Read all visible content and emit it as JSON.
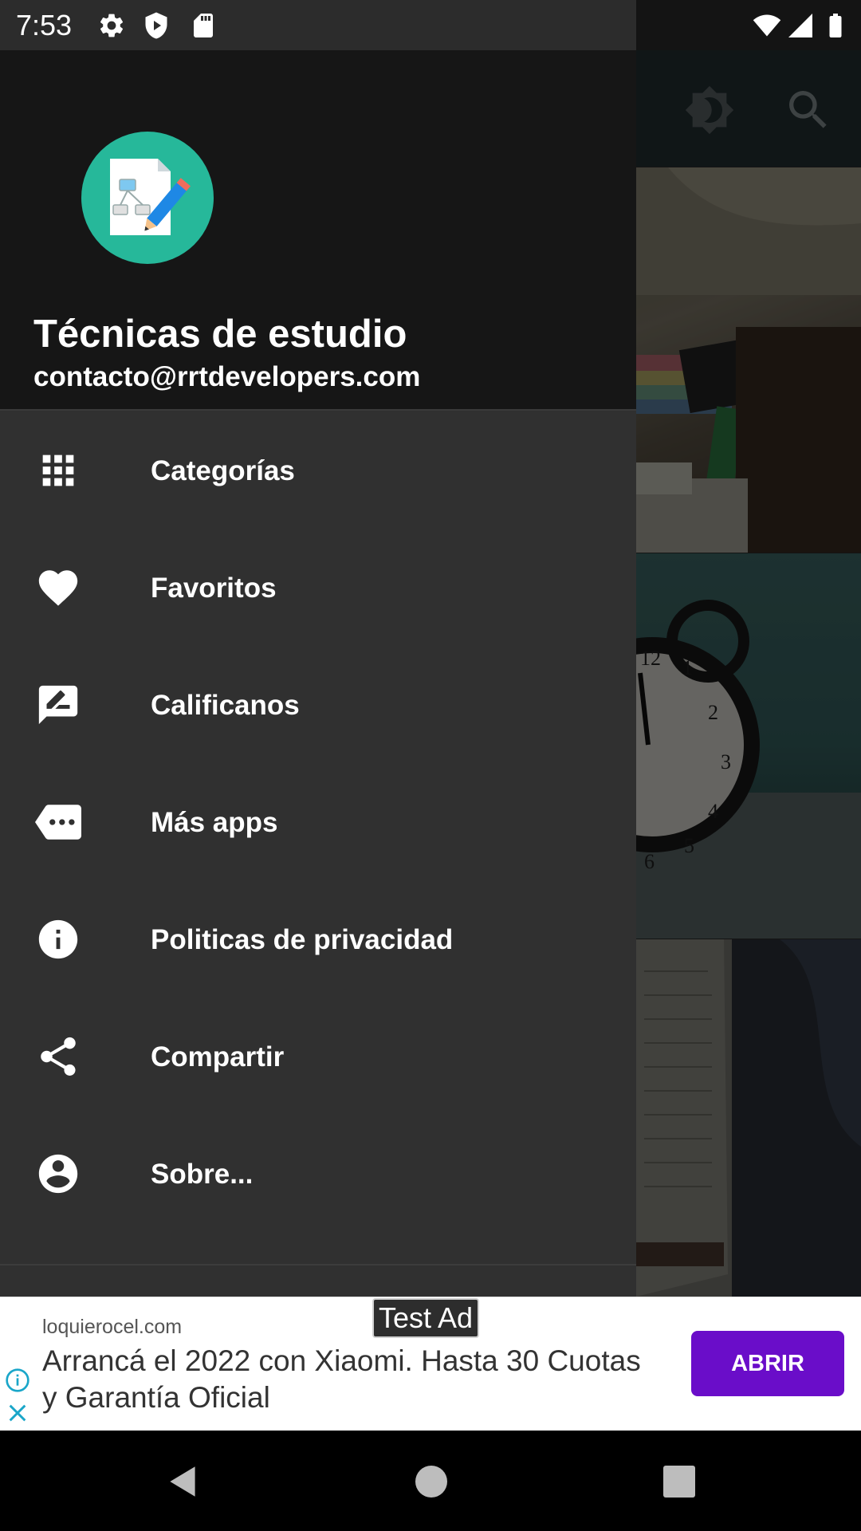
{
  "status_bar": {
    "time": "7:53",
    "left_icons": [
      "gear-icon",
      "shield-icon",
      "sd-card-icon"
    ],
    "right_icons": [
      "wifi-icon",
      "signal-icon",
      "battery-icon"
    ]
  },
  "toolbar": {
    "icons": [
      "brightness-icon",
      "search-icon"
    ]
  },
  "drawer": {
    "app_title": "Técnicas de estudio",
    "email": "contacto@rrtdevelopers.com",
    "items": [
      {
        "label": "Categorías",
        "icon": "grid-icon"
      },
      {
        "label": "Favoritos",
        "icon": "heart-icon"
      },
      {
        "label": "Calificanos",
        "icon": "rate-review-icon"
      },
      {
        "label": "Más apps",
        "icon": "more-apps-icon"
      },
      {
        "label": "Politicas de privacidad",
        "icon": "info-icon"
      },
      {
        "label": "Compartir",
        "icon": "share-icon"
      },
      {
        "label": "Sobre...",
        "icon": "account-circle-icon"
      }
    ]
  },
  "ad": {
    "tag": "Test Ad",
    "domain": "loquierocel.com",
    "headline": "Arrancá el 2022 con Xiaomi. Hasta 30 Cuotas y Garantía Oficial",
    "button_label": "ABRIR",
    "button_color": "#6a0dc9"
  },
  "navbar": {
    "icons": [
      "back-icon",
      "home-icon",
      "recents-icon"
    ]
  }
}
